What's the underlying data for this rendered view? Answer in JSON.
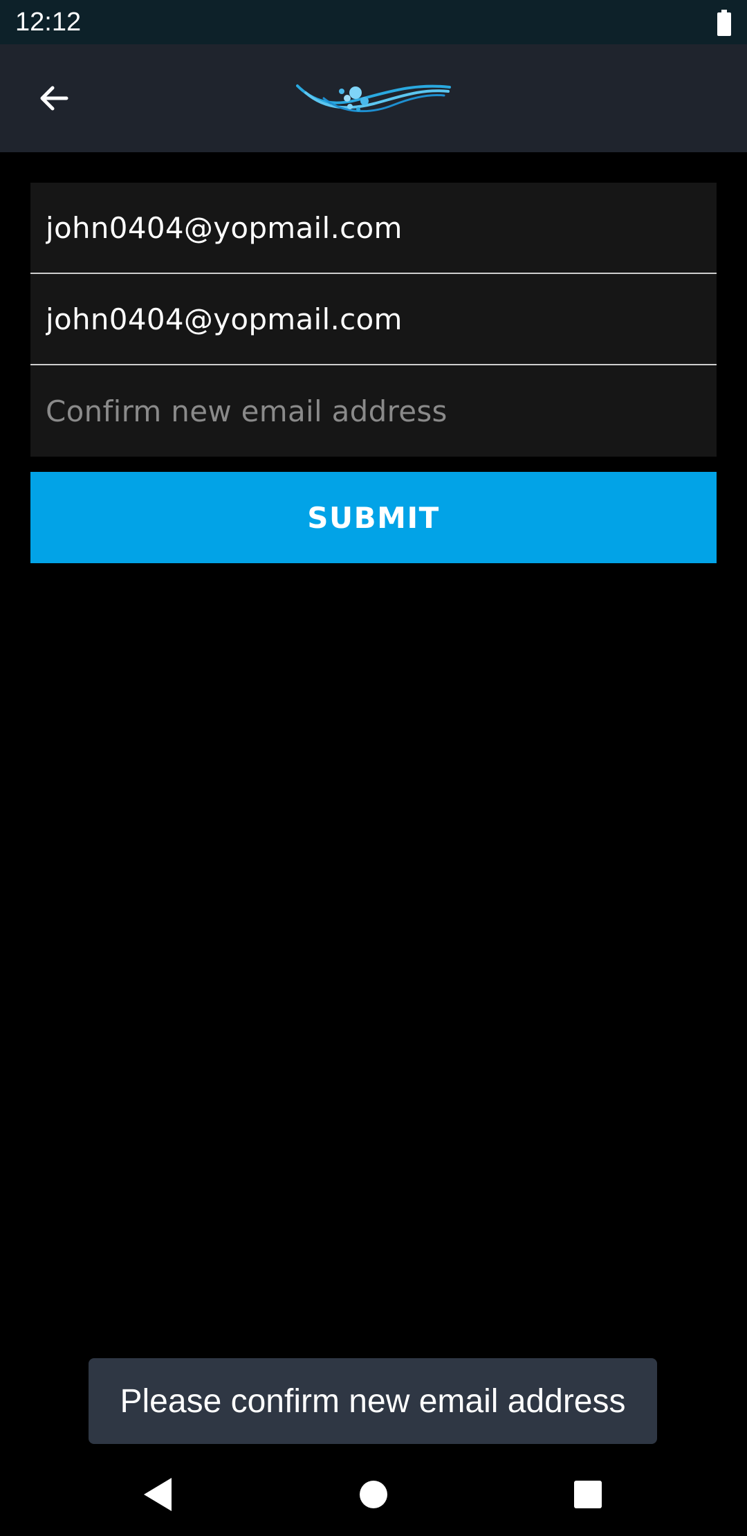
{
  "status_bar": {
    "time": "12:12",
    "battery_icon": "battery-full-icon"
  },
  "app_bar": {
    "back_icon": "arrow-left-icon",
    "logo_icon": "waves-bubbles-logo",
    "accent_color": "#2aa9e0"
  },
  "form": {
    "current_email": {
      "value": "john0404@yopmail.com"
    },
    "new_email": {
      "value": "john0404@yopmail.com"
    },
    "confirm_email": {
      "value": "",
      "placeholder": "Confirm new email address"
    },
    "submit_label": "SUBMIT",
    "submit_color": "#02a3e7"
  },
  "toast": {
    "message": "Please confirm new email address"
  },
  "nav_bar": {
    "back_icon": "triangle-back-icon",
    "home_icon": "circle-home-icon",
    "recents_icon": "square-recents-icon"
  }
}
